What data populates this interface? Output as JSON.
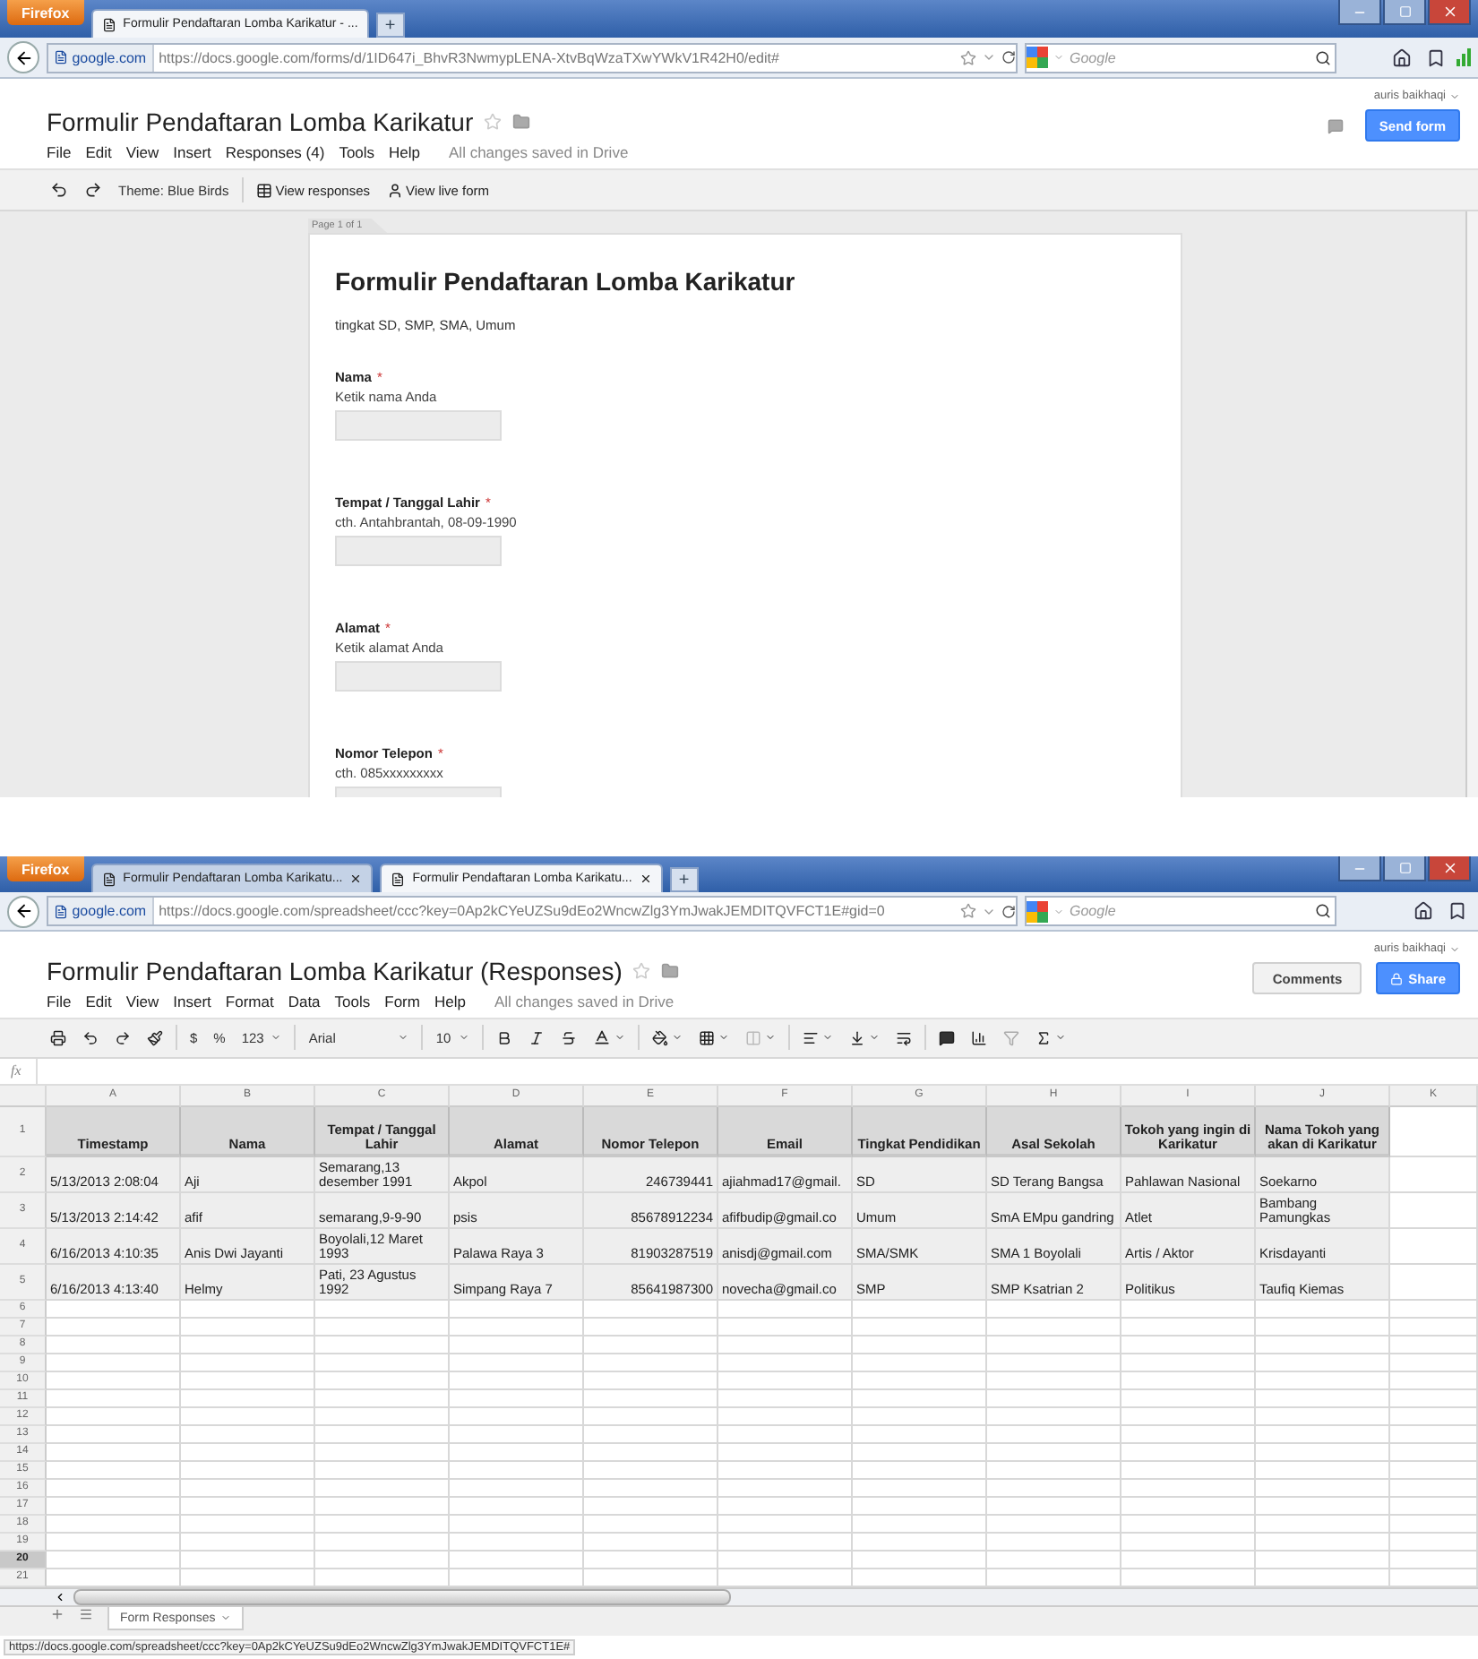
{
  "form_window": {
    "browser": {
      "menu_button": "Firefox",
      "tabs": [
        {
          "title": "Formulir Pendaftaran Lomba Karikatur - ...",
          "selected": true
        }
      ],
      "new_tab": "+",
      "identity": "google.com",
      "url": "https://docs.google.com/forms/d/1ID647i_BhvR3NwmypLENA-XtvBqWzaTXwYWkV1R42H0/edit#",
      "search_placeholder": "Google"
    },
    "doc_title": "Formulir Pendaftaran Lomba Karikatur",
    "menu": [
      "File",
      "Edit",
      "View",
      "Insert",
      "Responses (4)",
      "Tools",
      "Help"
    ],
    "save_status": "All changes saved in Drive",
    "user": "auris baikhaqi",
    "primary_button": "Send form",
    "toolbar": {
      "theme": "Theme: Blue Birds",
      "view_responses": "View responses",
      "view_live_form": "View live form"
    },
    "page_tab": "Page 1 of 1",
    "form": {
      "title": "Formulir Pendaftaran Lomba Karikatur",
      "description": "tingkat SD, SMP, SMA, Umum",
      "questions": [
        {
          "label": "Nama",
          "required_mark": "*",
          "help": "Ketik nama Anda"
        },
        {
          "label": "Tempat / Tanggal Lahir",
          "required_mark": "*",
          "help": "cth. Antahbrantah, 08-09-1990"
        },
        {
          "label": "Alamat",
          "required_mark": "*",
          "help": "Ketik alamat Anda"
        },
        {
          "label": "Nomor Telepon",
          "required_mark": "*",
          "help": "cth. 085xxxxxxxxx"
        }
      ]
    }
  },
  "sheet_window": {
    "browser": {
      "menu_button": "Firefox",
      "tabs": [
        {
          "title": "Formulir Pendaftaran Lomba Karikatu...",
          "selected": false
        },
        {
          "title": "Formulir Pendaftaran Lomba Karikatu...",
          "selected": true
        }
      ],
      "new_tab": "+",
      "identity": "google.com",
      "url": "https://docs.google.com/spreadsheet/ccc?key=0Ap2kCYeUZSu9dEo2WncwZlg3YmJwakJEMDITQVFCT1E#gid=0",
      "search_placeholder": "Google"
    },
    "doc_title": "Formulir Pendaftaran Lomba Karikatur (Responses)",
    "menu": [
      "File",
      "Edit",
      "View",
      "Insert",
      "Format",
      "Data",
      "Tools",
      "Form",
      "Help"
    ],
    "save_status": "All changes saved in Drive",
    "user": "auris baikhaqi",
    "comments_button": "Comments",
    "share_button": "Share",
    "toolbar": {
      "currency": "$",
      "percent": "%",
      "number_format": "123",
      "font": "Arial",
      "font_size": "10"
    },
    "formula_label": "fx",
    "columns": [
      {
        "letter": "A",
        "header": "Timestamp",
        "kind": "text"
      },
      {
        "letter": "B",
        "header": "Nama",
        "kind": "text"
      },
      {
        "letter": "C",
        "header": "Tempat / Tanggal Lahir",
        "kind": "text"
      },
      {
        "letter": "D",
        "header": "Alamat",
        "kind": "text"
      },
      {
        "letter": "E",
        "header": "Nomor Telepon",
        "kind": "number"
      },
      {
        "letter": "F",
        "header": "Email",
        "kind": "text"
      },
      {
        "letter": "G",
        "header": "Tingkat Pendidikan",
        "kind": "text"
      },
      {
        "letter": "H",
        "header": "Asal Sekolah",
        "kind": "text"
      },
      {
        "letter": "I",
        "header": "Tokoh yang ingin di Karikatur",
        "kind": "text"
      },
      {
        "letter": "J",
        "header": "Nama Tokoh yang akan di Karikatur",
        "kind": "text"
      },
      {
        "letter": "K"
      }
    ],
    "header_row_number": "1",
    "rows": [
      {
        "number": "2",
        "selected": false,
        "cells": [
          "5/13/2013 2:08:04",
          "Aji",
          "Semarang,13 desember 1991",
          "Akpol",
          "246739441",
          "ajiahmad17@gmail.",
          "SD",
          "SD Terang Bangsa",
          "Pahlawan Nasional",
          "Soekarno"
        ]
      },
      {
        "number": "3",
        "selected": false,
        "cells": [
          "5/13/2013 2:14:42",
          "afif",
          "semarang,9-9-90",
          "psis",
          "85678912234",
          "afifbudip@gmail.co",
          "Umum",
          "SmA EMpu gandring",
          "Atlet",
          "Bambang Pamungkas"
        ]
      },
      {
        "number": "4",
        "selected": false,
        "cells": [
          "6/16/2013 4:10:35",
          "Anis Dwi Jayanti",
          "Boyolali,12 Maret 1993",
          "Palawa Raya 3",
          "81903287519",
          "anisdj@gmail.com",
          "SMA/SMK",
          "SMA 1 Boyolali",
          "Artis / Aktor",
          "Krisdayanti"
        ]
      },
      {
        "number": "5",
        "selected": false,
        "cells": [
          "6/16/2013 4:13:40",
          "Helmy",
          "Pati, 23 Agustus 1992",
          "Simpang Raya 7",
          "85641987300",
          "novecha@gmail.co",
          "SMP",
          "SMP Ksatrian 2",
          "Politikus",
          "Taufiq Kiemas"
        ]
      }
    ],
    "empty_rows": [
      {
        "number": "6",
        "selected": false
      },
      {
        "number": "7",
        "selected": false
      },
      {
        "number": "8",
        "selected": false
      },
      {
        "number": "9",
        "selected": false
      },
      {
        "number": "10",
        "selected": false
      },
      {
        "number": "11",
        "selected": false
      },
      {
        "number": "12",
        "selected": false
      },
      {
        "number": "13",
        "selected": false
      },
      {
        "number": "14",
        "selected": false
      },
      {
        "number": "15",
        "selected": false
      },
      {
        "number": "16",
        "selected": false
      },
      {
        "number": "17",
        "selected": false
      },
      {
        "number": "18",
        "selected": false
      },
      {
        "number": "19",
        "selected": false
      },
      {
        "number": "20",
        "selected": true
      },
      {
        "number": "21",
        "selected": false
      }
    ],
    "sheet_tabs": [
      {
        "label": "Form Responses",
        "selected": true
      }
    ],
    "status_url": "https://docs.google.com/spreadsheet/ccc?key=0Ap2kCYeUZSu9dEo2WncwZlg3YmJwakJEMDITQVFCT1E#"
  }
}
